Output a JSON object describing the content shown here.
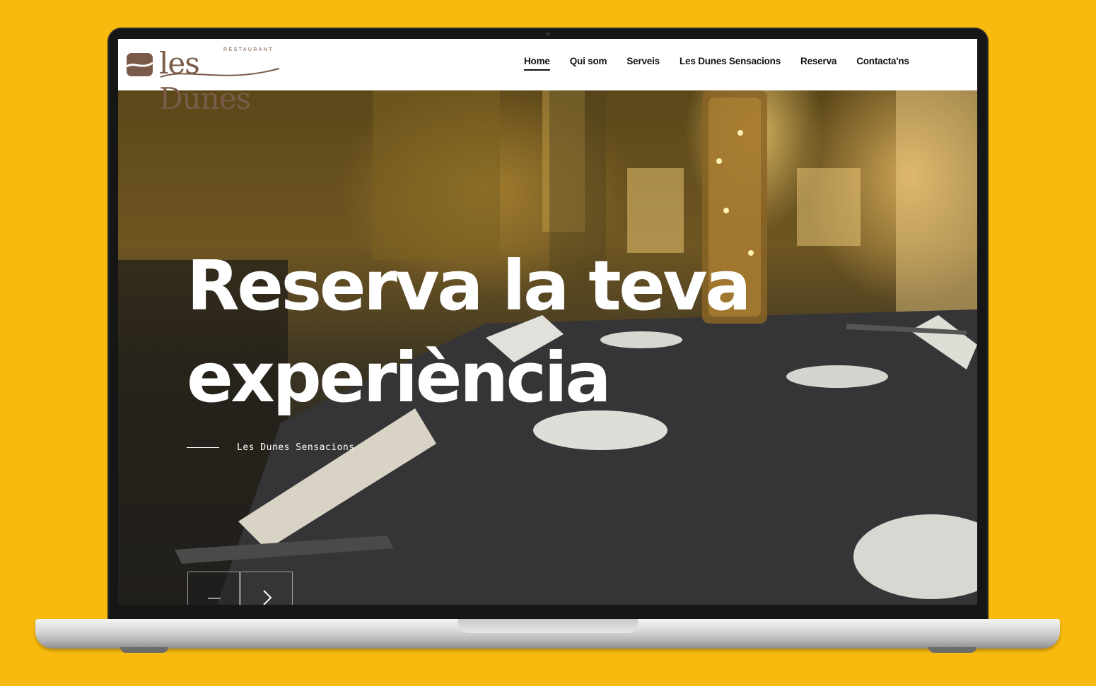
{
  "logo": {
    "word": "les Dunes",
    "sub": "RESTAURANT",
    "brand_color": "#7A5A48"
  },
  "nav": {
    "items": [
      {
        "label": "Home",
        "active": true
      },
      {
        "label": "Qui som",
        "active": false
      },
      {
        "label": "Serveis",
        "active": false
      },
      {
        "label": "Les Dunes Sensacions",
        "active": false
      },
      {
        "label": "Reserva",
        "active": false
      },
      {
        "label": "Contacta'ns",
        "active": false
      }
    ]
  },
  "hero": {
    "title_line1": "Reserva la teva",
    "title_line2": "experiència",
    "subtitle": "Les Dunes Sensacions",
    "prev_icon": "minus-icon",
    "next_icon": "chevron-right-icon"
  },
  "colors": {
    "background": "#F8BA0E",
    "header_bg": "#FFFFFF",
    "nav_text": "#111111",
    "hero_text": "#FFFFFF"
  }
}
